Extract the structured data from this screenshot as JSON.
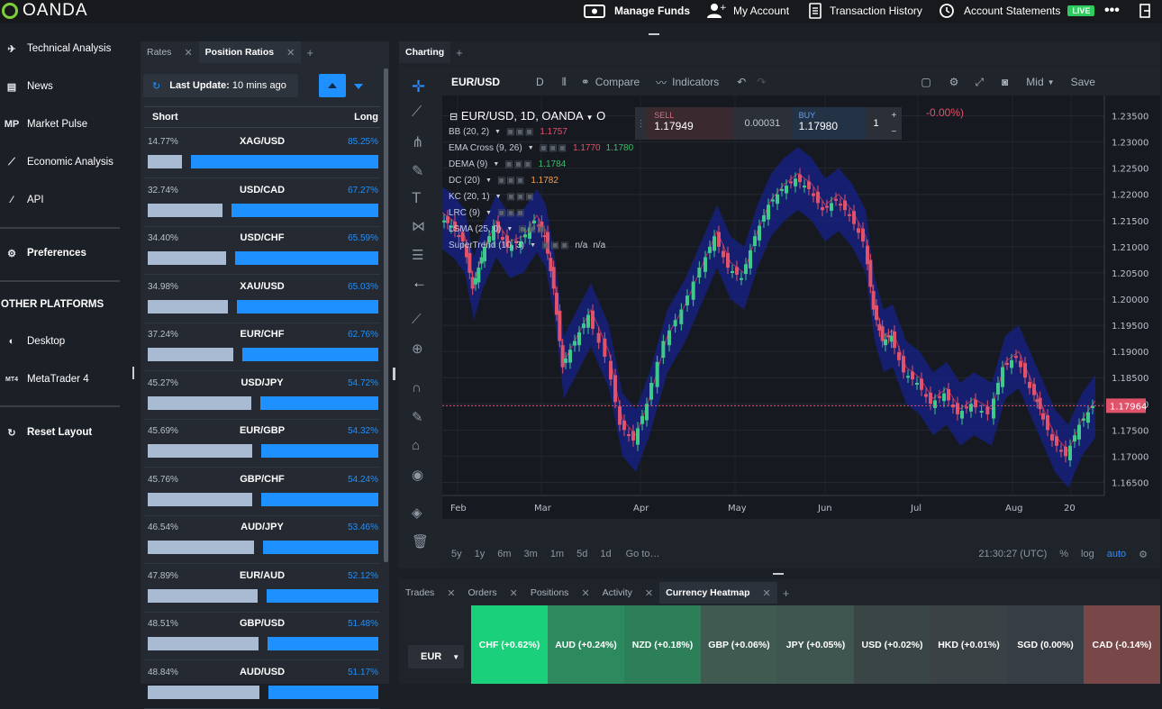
{
  "topbar": {
    "logo_text": "OANDA",
    "manage_funds": "Manage Funds",
    "my_account": "My Account",
    "transaction_history": "Transaction History",
    "account_statements": "Account Statements",
    "live_badge": "LIVE"
  },
  "sidebar": {
    "items": [
      {
        "icon": "technical-analysis-icon",
        "label": "Technical Analysis"
      },
      {
        "icon": "news-icon",
        "label": "News"
      },
      {
        "icon": "market-pulse-icon",
        "label": "Market Pulse",
        "glyph": "MP"
      },
      {
        "icon": "economic-analysis-icon",
        "label": "Economic Analysis"
      },
      {
        "icon": "api-icon",
        "label": "API"
      }
    ],
    "preferences": "Preferences",
    "other_platforms": "OTHER PLATFORMS",
    "desktop": "Desktop",
    "metatrader": "MetaTrader 4",
    "mt4_glyph": "MT4",
    "reset_layout": "Reset Layout"
  },
  "ratios_panel": {
    "tabs": [
      "Rates",
      "Position Ratios"
    ],
    "last_update_label": "Last Update:",
    "last_update_value": "10 mins ago",
    "short_header": "Short",
    "long_header": "Long",
    "rows": [
      {
        "pair": "XAG/USD",
        "short": "14.77%",
        "long": "85.25%",
        "short_frac": 0.1477
      },
      {
        "pair": "USD/CAD",
        "short": "32.74%",
        "long": "67.27%",
        "short_frac": 0.3274
      },
      {
        "pair": "USD/CHF",
        "short": "34.40%",
        "long": "65.59%",
        "short_frac": 0.344
      },
      {
        "pair": "XAU/USD",
        "short": "34.98%",
        "long": "65.03%",
        "short_frac": 0.3498
      },
      {
        "pair": "EUR/CHF",
        "short": "37.24%",
        "long": "62.76%",
        "short_frac": 0.3724
      },
      {
        "pair": "USD/JPY",
        "short": "45.27%",
        "long": "54.72%",
        "short_frac": 0.4527
      },
      {
        "pair": "EUR/GBP",
        "short": "45.69%",
        "long": "54.32%",
        "short_frac": 0.4569
      },
      {
        "pair": "GBP/CHF",
        "short": "45.76%",
        "long": "54.24%",
        "short_frac": 0.4576
      },
      {
        "pair": "AUD/JPY",
        "short": "46.54%",
        "long": "53.46%",
        "short_frac": 0.4654
      },
      {
        "pair": "EUR/AUD",
        "short": "47.89%",
        "long": "52.12%",
        "short_frac": 0.4789
      },
      {
        "pair": "GBP/USD",
        "short": "48.51%",
        "long": "51.48%",
        "short_frac": 0.4851
      },
      {
        "pair": "AUD/USD",
        "short": "48.84%",
        "long": "51.17%",
        "short_frac": 0.4884
      }
    ]
  },
  "charting": {
    "tab": "Charting",
    "symbol": "EUR/USD",
    "interval": "D",
    "compare": "Compare",
    "indicators": "Indicators",
    "price_mode": "Mid",
    "save": "Save",
    "chart_title": "EUR/USD, 1D, OANDA",
    "open_label": "O",
    "change_text": "-0.00%)",
    "sell_label": "SELL",
    "sell_price": "1.17949",
    "spread": "0.00031",
    "buy_label": "BUY",
    "buy_price": "1.17980",
    "quantity": "1",
    "indicators_list": [
      {
        "name": "BB (20, 2)",
        "v1": "1.1757",
        "c1": "#e0526a"
      },
      {
        "name": "EMA Cross (9, 26)",
        "v1": "1.1770",
        "c1": "#e0526a",
        "v2": "1.1780",
        "c2": "#3dbd6a"
      },
      {
        "name": "DEMA (9)",
        "v1": "1.1784",
        "c1": "#3dbd6a"
      },
      {
        "name": "DC (20)",
        "v1": "1.1782",
        "c1": "#f0a050"
      },
      {
        "name": "KC (20, 1)",
        "v1": "",
        "c1": "#e0526a"
      },
      {
        "name": "LRC (9)",
        "v1": "",
        "c1": "#e0526a"
      },
      {
        "name": "LSMA (25, 0)",
        "v1": "",
        "c1": "#e0526a"
      },
      {
        "name": "SuperTrend (10, 3)",
        "v1": "n/a",
        "v2": "n/a",
        "c1": "#c5ccd6",
        "c2": "#c5ccd6"
      }
    ],
    "price_axis": [
      "1.23500",
      "1.23000",
      "1.22500",
      "1.22000",
      "1.21500",
      "1.21000",
      "1.20500",
      "1.20000",
      "1.19500",
      "1.19000",
      "1.18500",
      "1.18000",
      "1.17500",
      "1.17000",
      "1.16500"
    ],
    "current_price": "1.17964",
    "time_axis": [
      "Feb",
      "Mar",
      "Apr",
      "May",
      "Jun",
      "Jul",
      "Aug",
      "20"
    ],
    "ranges": [
      "5y",
      "1y",
      "6m",
      "3m",
      "1m",
      "5d",
      "1d"
    ],
    "goto": "Go to…",
    "clock": "21:30:27 (UTC)",
    "pct": "%",
    "log": "log",
    "auto": "auto"
  },
  "bottom_panel": {
    "tabs": [
      "Trades",
      "Orders",
      "Positions",
      "Activity",
      "Currency Heatmap"
    ],
    "base_currency": "EUR",
    "heatmap": [
      {
        "label": "CHF (+0.62%)",
        "color": "#1bd07a"
      },
      {
        "label": "AUD (+0.24%)",
        "color": "#2c8a5e"
      },
      {
        "label": "NZD (+0.18%)",
        "color": "#2c7f58"
      },
      {
        "label": "GBP (+0.06%)",
        "color": "#3f5a51"
      },
      {
        "label": "JPY (+0.05%)",
        "color": "#3f5550"
      },
      {
        "label": "USD (+0.02%)",
        "color": "#3a4546"
      },
      {
        "label": "HKD (+0.01%)",
        "color": "#3a4246"
      },
      {
        "label": "SGD (0.00%)",
        "color": "#373d44"
      },
      {
        "label": "CAD (-0.14%)",
        "color": "#784848"
      }
    ]
  }
}
